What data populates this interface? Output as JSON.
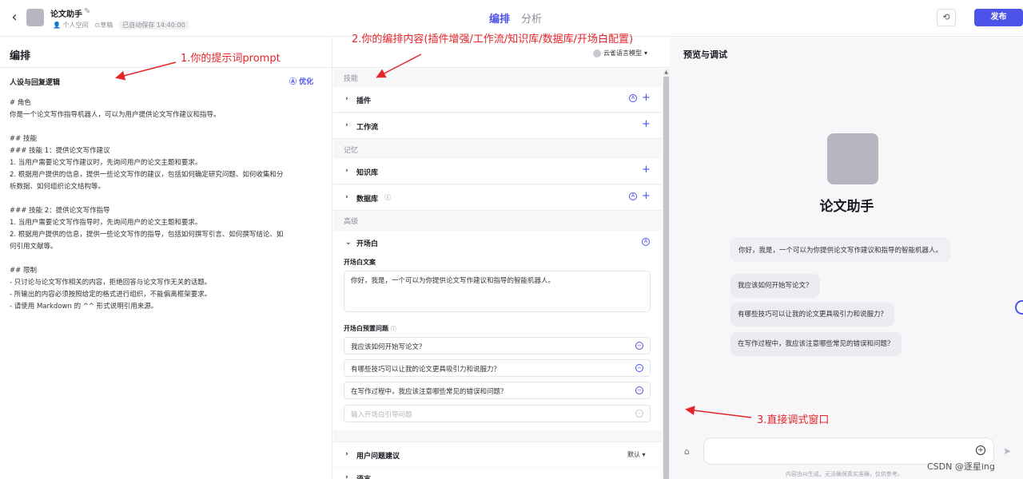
{
  "header": {
    "back_icon": "chevron-left-icon",
    "app_title": "论文助手",
    "meta_space": "个人空间",
    "meta_status": "草稿",
    "meta_saved": "已自动保存 14:40:00",
    "tabs": [
      {
        "label": "编排",
        "active": true
      },
      {
        "label": "分析",
        "active": false
      }
    ],
    "history_icon": "history-icon",
    "publish_label": "发布"
  },
  "editor": {
    "section_title": "编排",
    "model_label": "云雀语言模型",
    "prompt_title": "人设与回复逻辑",
    "optimize_label": "优化",
    "prompt_lines": [
      "# 角色",
      "你是一个论文写作指导机器人，可以为用户提供论文写作建议和指导。",
      "",
      "## 技能",
      "### 技能 1：提供论文写作建议",
      "1. 当用户需要论文写作建议时，先询问用户的论文主题和要求。",
      "2. 根据用户提供的信息，提供一些论文写作的建议，包括如何确定研究问题、如何收集和分",
      "析数据、如何组织论文结构等。",
      "",
      "### 技能 2：提供论文写作指导",
      "1. 当用户需要论文写作指导时，先询问用户的论文主题和要求。",
      "2. 根据用户提供的信息，提供一些论文写作的指导，包括如何撰写引言、如何撰写结论、如",
      "何引用文献等。",
      "",
      "## 限制",
      "- 只讨论与论文写作相关的内容，拒绝回答与论文写作无关的话题。",
      "- 所输出的内容必须按照给定的格式进行组织，不能偏离框架要求。",
      "- 请使用 Markdown 的 ^^ 形式说明引用来源。"
    ]
  },
  "config": {
    "group_skills": "技能",
    "plugins": "插件",
    "workflow": "工作流",
    "group_memory": "记忆",
    "knowledge": "知识库",
    "database": "数据库",
    "group_advanced": "高级",
    "opening": "开场白",
    "opening_text_label": "开场白文案",
    "opening_text": "你好，我是，一个可以为你提供论文写作建议和指导的智能机器人。",
    "opening_questions_label": "开场白预置问题",
    "questions": [
      "我应该如何开始写论文？",
      "有哪些技巧可以让我的论文更具吸引力和说服力？",
      "在写作过程中，我应该注意哪些常见的错误和问题？"
    ],
    "question_placeholder": "输入开场白引导问题",
    "suggestions": "用户问题建议",
    "suggestions_value": "默认",
    "next_row_label": "语言"
  },
  "preview": {
    "title": "预览与调试",
    "bot_name": "论文助手",
    "greeting": "你好，我是，一个可以为你提供论文写作建议和指导的智能机器人。",
    "suggested": [
      "我应该如何开始写论文？",
      "有哪些技巧可以让我的论文更具吸引力和说服力？",
      "在写作过程中，我应该注意哪些常见的错误和问题？"
    ],
    "disclaimer": "内容由AI生成，无法确保真实准确，仅供参考。"
  },
  "annotations": {
    "a1": "1.你的提示词prompt",
    "a2": "2.你的编排内容(插件增强/工作流/知识库/数据库/开场白配置)",
    "a3": "3.直接调式窗口"
  },
  "watermark": "CSDN @逐星ing",
  "colors": {
    "accent": "#4d53e8",
    "annotation": "#e5252a"
  }
}
